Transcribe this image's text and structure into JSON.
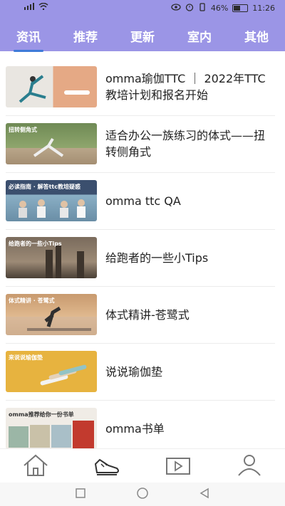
{
  "status_bar": {
    "battery": "46%",
    "time": "11:26"
  },
  "tabs": [
    {
      "label": "资讯",
      "active": true
    },
    {
      "label": "推荐",
      "active": false
    },
    {
      "label": "更新",
      "active": false
    },
    {
      "label": "室内",
      "active": false
    },
    {
      "label": "其他",
      "active": false
    }
  ],
  "articles": [
    {
      "title": "omma瑜伽TTC ｜ 2022年TTC教培计划和报名开始",
      "thumb_text": ""
    },
    {
      "title": "适合办公一族练习的体式——扭转侧角式",
      "thumb_text": "扭转侧角式"
    },
    {
      "title": "omma ttc QA",
      "thumb_text": "必读指南 · 解答ttc教培疑惑"
    },
    {
      "title": "给跑者的一些小Tips",
      "thumb_text": "给跑者的一些小Tips"
    },
    {
      "title": "体式精讲-苍鹭式",
      "thumb_text": "体式精讲 · 苍鹭式"
    },
    {
      "title": "说说瑜伽垫",
      "thumb_text": "来说说瑜伽垫"
    },
    {
      "title": "omma书单",
      "thumb_text": "omma推荐给你一份书单"
    }
  ],
  "bottom_nav": [
    {
      "icon": "home-icon"
    },
    {
      "icon": "shoe-icon"
    },
    {
      "icon": "video-icon"
    },
    {
      "icon": "user-icon"
    }
  ],
  "colors": {
    "header": "#9b95e6",
    "tab_indicator": "#3e7bd8"
  }
}
